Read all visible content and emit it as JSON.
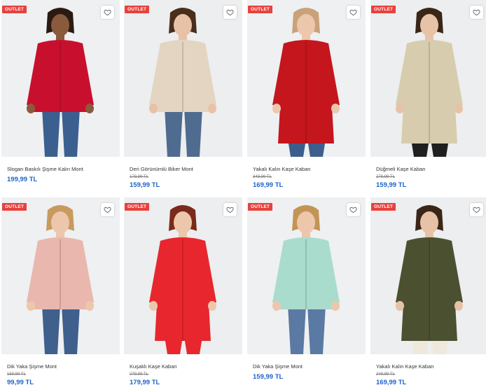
{
  "badge_label": "OUTLET",
  "products": [
    {
      "name": "Slogan Baskılı Şişme Kalın Mont",
      "old_price": "",
      "price": "199,99 TL",
      "colors": {
        "bg": "#eef0f2",
        "coat": "#c8102e",
        "pants": "#3b5f8f",
        "skin": "#8a5a3c",
        "hair": "#2a1a12"
      }
    },
    {
      "name": "Deri Görünümlü Biker Mont",
      "old_price": "179,99 TL",
      "price": "159,99 TL",
      "colors": {
        "bg": "#eceeef",
        "coat": "#e3d5c1",
        "pants": "#4f6b8f",
        "skin": "#e8c2a6",
        "hair": "#4a2e1c"
      }
    },
    {
      "name": "Yakalı Kalın Kaşe Kaban",
      "old_price": "349,99 TL",
      "price": "169,99 TL",
      "colors": {
        "bg": "#eef0f2",
        "coat": "#c4161c",
        "pants": "#3d5d8c",
        "skin": "#ecc7ab",
        "hair": "#c9a27a"
      }
    },
    {
      "name": "Düğmeli Kaşe Kaban",
      "old_price": "279,99 TL",
      "price": "159,99 TL",
      "colors": {
        "bg": "#eceeef",
        "coat": "#d8ccae",
        "pants": "#1f1f1f",
        "skin": "#e8c2a6",
        "hair": "#3a2618"
      }
    },
    {
      "name": "Dik Yaka Şişme Mont",
      "old_price": "159,99 TL",
      "price": "99,99 TL",
      "colors": {
        "bg": "#eef0f2",
        "coat": "#e9b7ad",
        "pants": "#3f5f8c",
        "skin": "#ecc7ab",
        "hair": "#c99a5e"
      }
    },
    {
      "name": "Kuşaklı Kaşe Kaban",
      "old_price": "279,99 TL",
      "price": "179,99 TL",
      "colors": {
        "bg": "#eceeef",
        "coat": "#e8262e",
        "pants": "#e8262e",
        "skin": "#ecc7ab",
        "hair": "#7a2a1a"
      }
    },
    {
      "name": "Dik Yaka Şişme Mont",
      "old_price": "",
      "price": "159,99 TL",
      "colors": {
        "bg": "#eef0f2",
        "coat": "#a9dccd",
        "pants": "#5a79a3",
        "skin": "#ecc7ab",
        "hair": "#c29556"
      }
    },
    {
      "name": "Yakalı Kalın Kaşe Kaban",
      "old_price": "249,99 TL",
      "price": "169,99 TL",
      "colors": {
        "bg": "#eceeef",
        "coat": "#4b5130",
        "pants": "#efe8dc",
        "skin": "#e8c2a6",
        "hair": "#3a2618"
      }
    }
  ]
}
